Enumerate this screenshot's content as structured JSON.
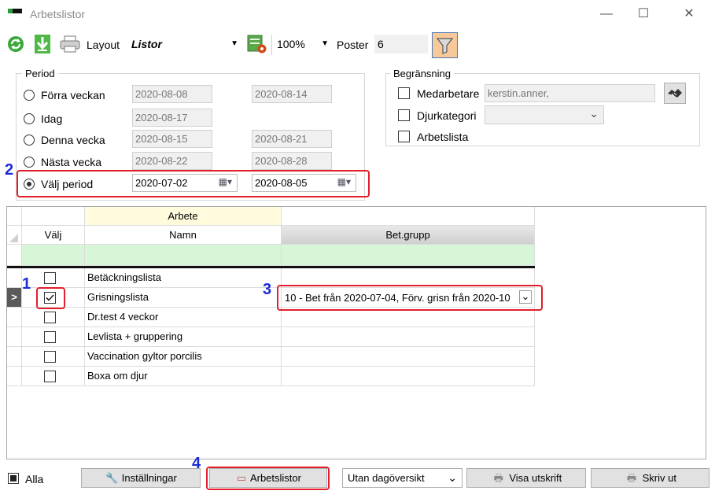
{
  "window": {
    "title": "Arbetslistor",
    "minimize": "—",
    "maximize": "☐",
    "close": "✕"
  },
  "toolbar": {
    "layout_label": "Layout",
    "layout_value": "Listor",
    "zoom_value": "100%",
    "poster_label": "Poster",
    "poster_value": "6"
  },
  "period": {
    "title": "Period",
    "options": [
      {
        "label": "Förra veckan",
        "from": "2020-08-08",
        "to": "2020-08-14"
      },
      {
        "label": "Idag",
        "from": "2020-08-17",
        "to": ""
      },
      {
        "label": "Denna vecka",
        "from": "2020-08-15",
        "to": "2020-08-21"
      },
      {
        "label": "Nästa vecka",
        "from": "2020-08-22",
        "to": "2020-08-28"
      },
      {
        "label": "Välj period",
        "from": "2020-07-02",
        "to": "2020-08-05"
      }
    ],
    "selected_index": 4
  },
  "limits": {
    "title": "Begränsning",
    "medarbetare_label": "Medarbetare",
    "medarbetare_value": "kerstin.anner,",
    "djurkategori_label": "Djurkategori",
    "djurkategori_value": "",
    "arbetslista_label": "Arbetslista"
  },
  "grid": {
    "group_header": "Arbete",
    "col_valj": "Välj",
    "col_namn": "Namn",
    "col_betgrupp": "Bet.grupp",
    "rows": [
      {
        "name": "Betäckningslista",
        "checked": false,
        "betgrupp": ""
      },
      {
        "name": "Grisningslista",
        "checked": true,
        "betgrupp": "10 -  Bet från 2020-07-04,  Förv. grisn från 2020-10",
        "current": true
      },
      {
        "name": "Dr.test 4 veckor",
        "checked": false,
        "betgrupp": ""
      },
      {
        "name": "Levlista + gruppering",
        "checked": false,
        "betgrupp": ""
      },
      {
        "name": "Vaccination gyltor porcilis",
        "checked": false,
        "betgrupp": ""
      },
      {
        "name": "Boxa om djur",
        "checked": false,
        "betgrupp": ""
      }
    ],
    "row_pointer": ">"
  },
  "callouts": {
    "one": "1",
    "two": "2",
    "three": "3",
    "four": "4"
  },
  "bottom": {
    "alla_label": "Alla",
    "installningar": "Inställningar",
    "arbetslistor": "Arbetslistor",
    "dagoversikt": "Utan dagöversikt",
    "visa_utskrift": "Visa utskrift",
    "skriv_ut": "Skriv ut"
  },
  "colors": {
    "accent_red": "#e0202a",
    "callout_blue": "#1a2bd8",
    "filter_active": "#f7c89a",
    "header_yellow": "#fffbdc",
    "filter_row_green": "#d7f5d7",
    "betgrupp_header": "#dadada"
  }
}
